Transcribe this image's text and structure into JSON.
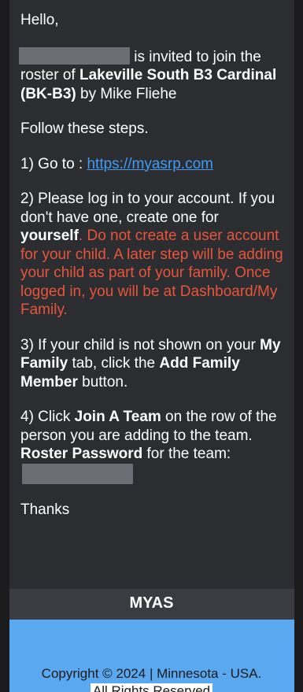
{
  "email": {
    "greeting": "Hello,",
    "invite": {
      "text_after_name": "is invited to join the roster of ",
      "team_name": "Lakeville South B3 Cardinal (BK-B3)",
      "by_text": " by Mike Fliehe"
    },
    "intro": "Follow these steps.",
    "step1": {
      "prefix": "1) Go to : ",
      "link": "https://myasrp.com"
    },
    "step2": {
      "prefix": "2)  Please log in to your account.  If you don't have one, create one for ",
      "bold": "yourself",
      "dot": ".",
      "warning": " Do not create a user account for your child. A later step will be adding your child as part of your family.  Once logged in, you will be at Dashboard/My Family."
    },
    "step3": {
      "prefix": "3) If your child is not shown on your ",
      "bold1": "My Family",
      "mid": " tab, click the ",
      "bold2": "Add Family Member",
      "suffix": " button."
    },
    "step4": {
      "prefix": "4) Click ",
      "bold1": "Join A Team",
      "mid": " on the row of the person you are adding to the team. ",
      "bold2": "Roster Password",
      "suffix": " for the team:"
    },
    "closing": "Thanks"
  },
  "footer": {
    "brand": "MYAS",
    "copyright": "Copyright © 2024 | Minnesota - USA.",
    "rights": "All Rights Reserved"
  },
  "colors": {
    "background": "#1c1c1e",
    "email_panel": "#2b2d31",
    "warning_red": "#e8553a",
    "link_blue": "#3f9bf4",
    "footer_blue": "#5aa8f0"
  }
}
